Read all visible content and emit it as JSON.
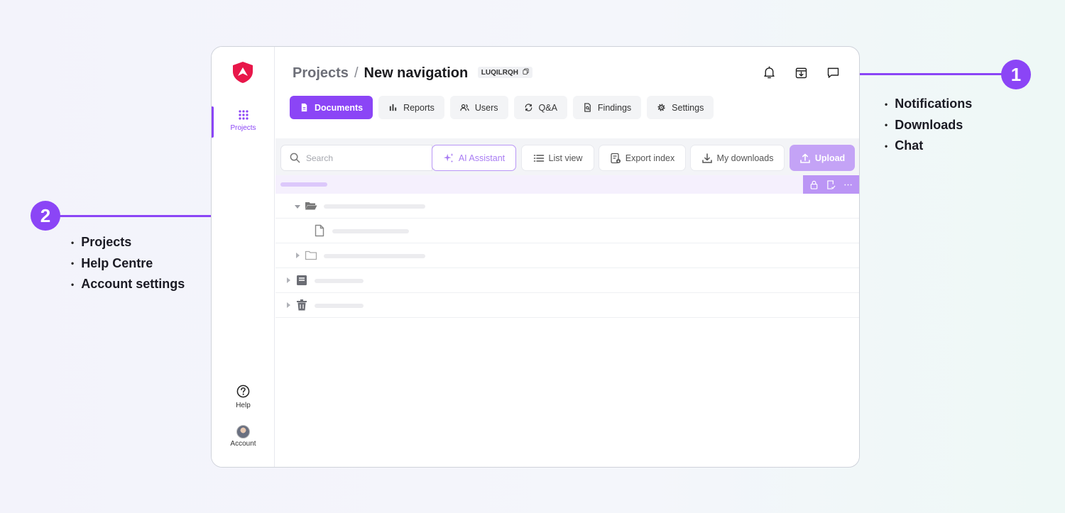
{
  "annotations": {
    "callout_1": {
      "number": "1",
      "items": [
        "Notifications",
        "Downloads",
        "Chat"
      ]
    },
    "callout_2": {
      "number": "2",
      "items": [
        "Projects",
        "Help Centre",
        "Account settings"
      ]
    },
    "accent_color": "#8b45f6"
  },
  "sidebar": {
    "logo": "brand-shield-logo",
    "items": [
      {
        "label": "Projects",
        "icon": "grid-dots-icon",
        "active": true
      },
      {
        "label": "Help",
        "icon": "question-circle-icon"
      },
      {
        "label": "Account",
        "icon": "avatar"
      }
    ]
  },
  "header": {
    "breadcrumb_root": "Projects",
    "separator": "/",
    "project_name": "New navigation",
    "project_code": "LUQILRQH",
    "icons": [
      "bell-icon",
      "download-box-icon",
      "chat-icon"
    ]
  },
  "tabs": [
    {
      "label": "Documents",
      "icon": "document-icon",
      "active": true
    },
    {
      "label": "Reports",
      "icon": "bar-chart-icon"
    },
    {
      "label": "Users",
      "icon": "users-icon"
    },
    {
      "label": "Q&A",
      "icon": "qa-sync-icon"
    },
    {
      "label": "Findings",
      "icon": "findings-icon"
    },
    {
      "label": "Settings",
      "icon": "gear-icon"
    }
  ],
  "toolbar": {
    "search_placeholder": "Search",
    "ai_assistant": "AI Assistant",
    "list_view": "List view",
    "export_index": "Export index",
    "my_downloads": "My downloads",
    "upload": "Upload"
  }
}
